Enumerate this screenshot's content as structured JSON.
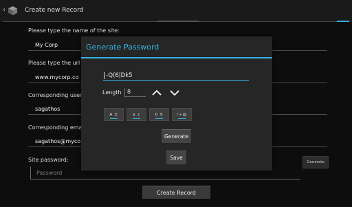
{
  "action_bar": {
    "title": "Create new Record",
    "up_glyph": "‹",
    "icon": "app-cube-icon"
  },
  "form": {
    "site_name_label": "Please type the name of the site:",
    "site_name_value": "My Corp",
    "site_url_label": "Please type the url o",
    "site_url_value": "www.mycorp.co",
    "user_label": "Corresponding user",
    "user_value": "sagathos",
    "email_label": "Corresponding email",
    "email_value": "sagathos@myco",
    "password_label": "Site password:",
    "password_placeholder": "Password",
    "generate_label": "Generate",
    "create_label": "Create Record"
  },
  "dialog": {
    "title": "Generate Password",
    "password_value": "-Q(6|Dk5",
    "length_label": "Length",
    "length_value": "8",
    "increase_icon": "chevron-up-icon",
    "decrease_icon": "chevron-down-icon",
    "toggles": [
      {
        "label": "A Z",
        "checked": true
      },
      {
        "label": "a z",
        "checked": true
      },
      {
        "label": "0 9",
        "checked": true
      },
      {
        "label": "!÷@",
        "checked": true
      }
    ],
    "generate_label": "Generate",
    "save_label": "Save"
  },
  "colors": {
    "accent": "#33b5e5",
    "background": "#0d0d0d",
    "dialog": "#262626"
  }
}
